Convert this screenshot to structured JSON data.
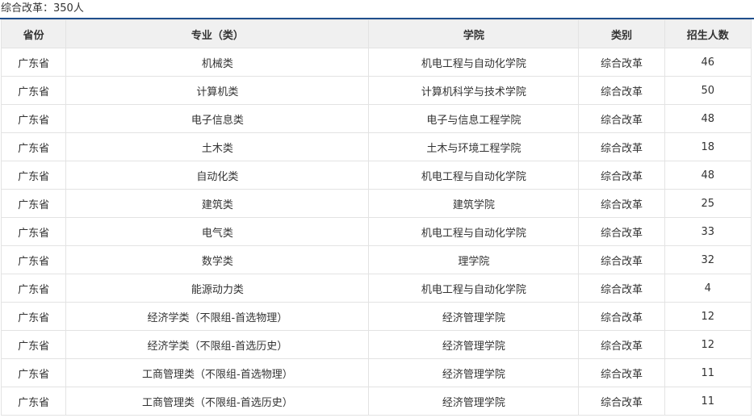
{
  "summary": {
    "label": "综合改革：350人"
  },
  "table": {
    "headers": [
      "省份",
      "专业（类）",
      "学院",
      "类别",
      "招生人数"
    ],
    "rows": [
      [
        "广东省",
        "机械类",
        "机电工程与自动化学院",
        "综合改革",
        "46"
      ],
      [
        "广东省",
        "计算机类",
        "计算机科学与技术学院",
        "综合改革",
        "50"
      ],
      [
        "广东省",
        "电子信息类",
        "电子与信息工程学院",
        "综合改革",
        "48"
      ],
      [
        "广东省",
        "土木类",
        "土木与环境工程学院",
        "综合改革",
        "18"
      ],
      [
        "广东省",
        "自动化类",
        "机电工程与自动化学院",
        "综合改革",
        "48"
      ],
      [
        "广东省",
        "建筑类",
        "建筑学院",
        "综合改革",
        "25"
      ],
      [
        "广东省",
        "电气类",
        "机电工程与自动化学院",
        "综合改革",
        "33"
      ],
      [
        "广东省",
        "数学类",
        "理学院",
        "综合改革",
        "32"
      ],
      [
        "广东省",
        "能源动力类",
        "机电工程与自动化学院",
        "综合改革",
        "4"
      ],
      [
        "广东省",
        "经济学类（不限组-首选物理）",
        "经济管理学院",
        "综合改革",
        "12"
      ],
      [
        "广东省",
        "经济学类（不限组-首选历史）",
        "经济管理学院",
        "综合改革",
        "12"
      ],
      [
        "广东省",
        "工商管理类（不限组-首选物理）",
        "经济管理学院",
        "综合改革",
        "11"
      ],
      [
        "广东省",
        "工商管理类（不限组-首选历史）",
        "经济管理学院",
        "综合改革",
        "11"
      ]
    ]
  }
}
